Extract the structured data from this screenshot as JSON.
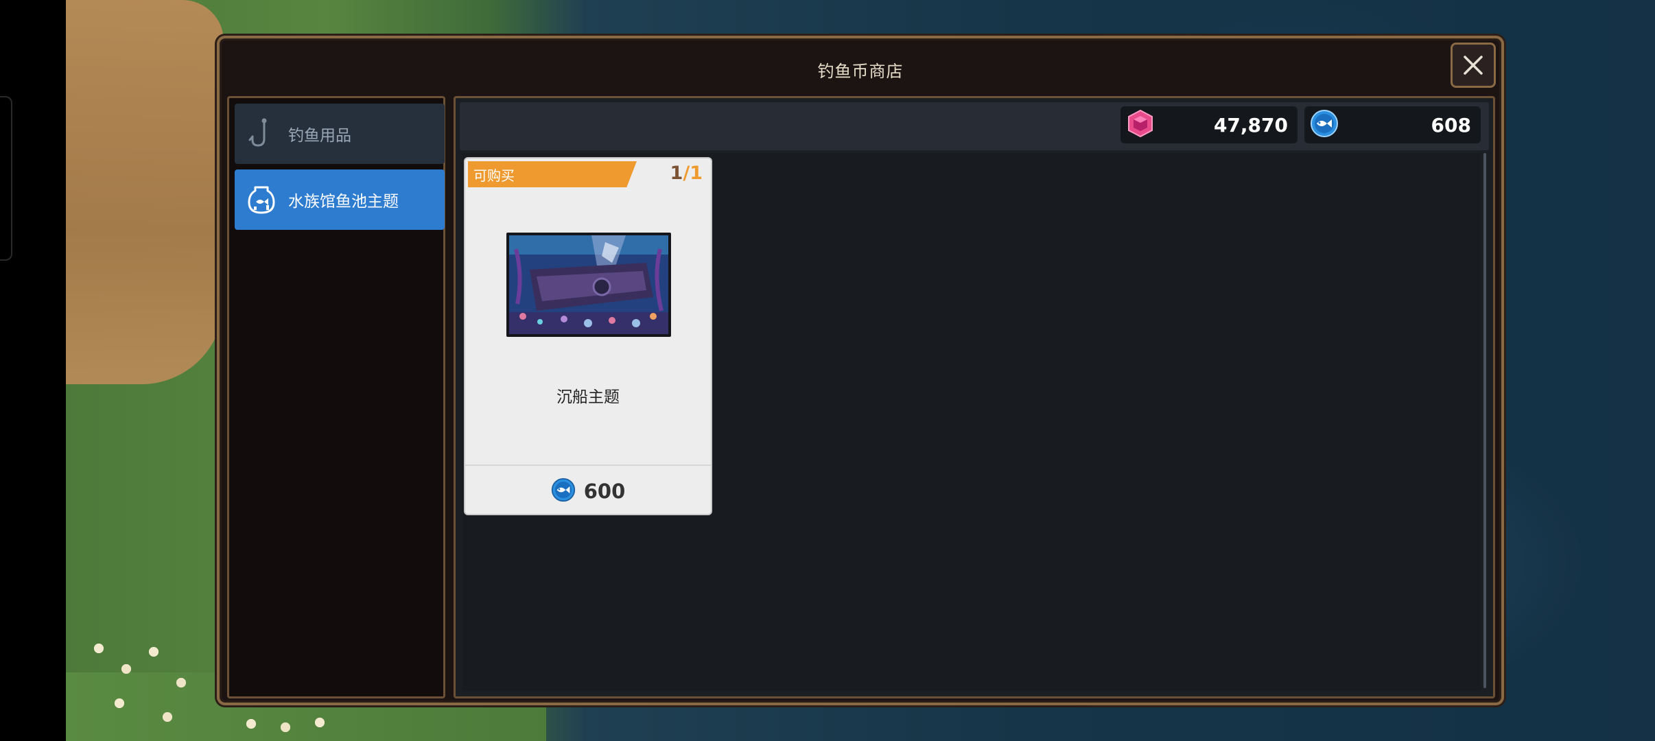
{
  "modal": {
    "title": "钓鱼币商店"
  },
  "sidebar": {
    "items": [
      {
        "label": "钓鱼用品",
        "icon": "fishing-hook-icon",
        "selected": false
      },
      {
        "label": "水族馆鱼池主题",
        "icon": "fishbowl-icon",
        "selected": true
      }
    ]
  },
  "currencies": {
    "gems": {
      "icon": "gem-icon",
      "value": "47,870"
    },
    "fish_coins": {
      "icon": "fish-coin-icon",
      "value": "608"
    }
  },
  "shop_items": [
    {
      "status_tag": "可购买",
      "stock_current": "1",
      "stock_separator": "/",
      "stock_max": "1",
      "name": "沉船主题",
      "price_icon": "fish-coin-icon",
      "price": "600"
    }
  ],
  "colors": {
    "accent_selected": "#2d7cd0",
    "tag_orange": "#ee9a2f",
    "frame_border": "#8a6a44"
  }
}
